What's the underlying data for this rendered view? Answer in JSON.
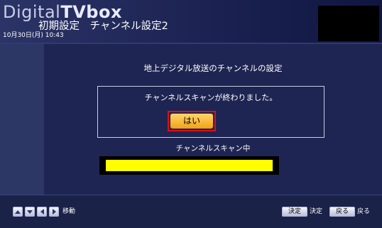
{
  "header": {
    "brand_prefix": "Digital",
    "brand_suffix": "TVbox",
    "title": "初期設定　チャンネル設定2",
    "datetime": "10月30日(月)  10:43"
  },
  "main": {
    "section_title": "地上デジタル放送のチャンネルの設定",
    "dialog": {
      "message": "チャンネルスキャンが終わりました。",
      "yes_label": "はい"
    },
    "progress": {
      "label": "チャンネルスキャン中",
      "fraction": 1.0,
      "color": "#ffff00"
    }
  },
  "footer": {
    "nav_icons": [
      "up-arrow-icon",
      "down-arrow-icon",
      "left-arrow-icon",
      "right-arrow-icon"
    ],
    "move_label": "移動",
    "decide_key": "決定",
    "decide_label": "決定",
    "back_key": "戻る",
    "back_label": "戻る"
  },
  "colors": {
    "background": "#1a2248",
    "sidebar": "#2c3766",
    "button_yellow": "#f2a315",
    "focus_red": "#e01010"
  }
}
